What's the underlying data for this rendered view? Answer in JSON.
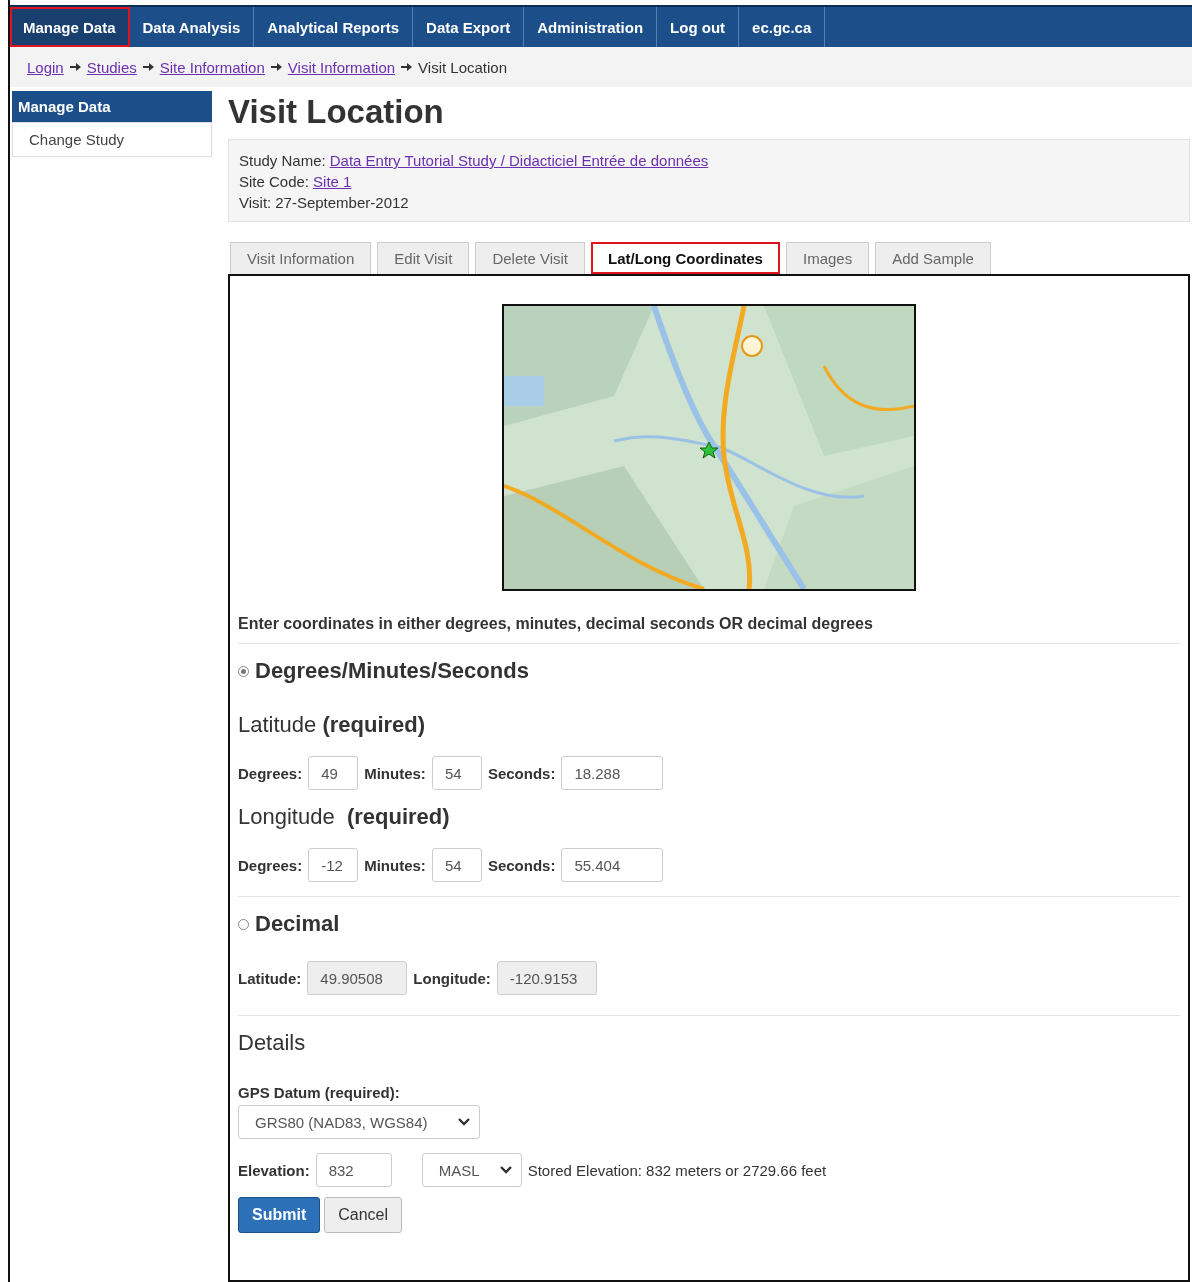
{
  "nav": {
    "items": [
      {
        "label": "Manage Data",
        "selected": true,
        "highlighted": true
      },
      {
        "label": "Data Analysis",
        "selected": false,
        "highlighted": false
      },
      {
        "label": "Analytical Reports",
        "selected": false,
        "highlighted": false
      },
      {
        "label": "Data Export",
        "selected": false,
        "highlighted": false
      },
      {
        "label": "Administration",
        "selected": false,
        "highlighted": false
      },
      {
        "label": "Log out",
        "selected": false,
        "highlighted": false
      },
      {
        "label": "ec.gc.ca",
        "selected": false,
        "highlighted": false
      }
    ]
  },
  "breadcrumb": [
    {
      "label": "Login",
      "link": true
    },
    {
      "label": "Studies",
      "link": true
    },
    {
      "label": "Site Information",
      "link": true
    },
    {
      "label": "Visit Information",
      "link": true
    },
    {
      "label": "Visit Location",
      "link": false
    }
  ],
  "sidebar": {
    "title": "Manage Data",
    "items": [
      {
        "label": "Change Study"
      }
    ]
  },
  "page_title": "Visit Location",
  "study_info": [
    {
      "label": "Study Name:",
      "value": "Data Entry Tutorial Study / Didacticiel Entrée de données",
      "link": true
    },
    {
      "label": "Site Code:",
      "value": "Site 1",
      "link": true
    },
    {
      "label": "Visit:",
      "value": "27-September-2012",
      "link": false
    }
  ],
  "tabs": [
    {
      "label": "Visit Information",
      "selected": false,
      "highlighted": false
    },
    {
      "label": "Edit Visit",
      "selected": false,
      "highlighted": false
    },
    {
      "label": "Delete Visit",
      "selected": false,
      "highlighted": false
    },
    {
      "label": "Lat/Long Coordinates",
      "selected": true,
      "highlighted": true
    },
    {
      "label": "Images",
      "selected": false,
      "highlighted": false
    },
    {
      "label": "Add Sample",
      "selected": false,
      "highlighted": false
    }
  ],
  "instructions": "Enter coordinates in either degrees, minutes, decimal seconds OR decimal degrees",
  "dms": {
    "label": "Degrees/Minutes/Seconds",
    "selected": true,
    "groups": [
      {
        "title": "Latitude **(required)**",
        "fields": [
          {
            "label": "Degrees:",
            "value": "49"
          },
          {
            "label": "Minutes:",
            "value": "54"
          },
          {
            "label": "Seconds:",
            "value": "18.288"
          }
        ]
      },
      {
        "title": "Longitude  **(required)**",
        "fields": [
          {
            "label": "Degrees:",
            "value": "-12"
          },
          {
            "label": "Minutes:",
            "value": "54"
          },
          {
            "label": "Seconds:",
            "value": "55.404"
          }
        ]
      }
    ]
  },
  "decimal": {
    "label": "Decimal",
    "selected": false,
    "fields": [
      {
        "label": "Latitude:",
        "value": "49.90508",
        "disabled": true
      },
      {
        "label": "Longitude:",
        "value": "-120.9153",
        "disabled": true
      }
    ]
  },
  "details": {
    "title": "Details",
    "datum": {
      "label": "GPS Datum (required):",
      "value": "GRS80 (NAD83, WGS84)"
    },
    "elevation": {
      "label": "Elevation:",
      "value": "832",
      "unit": "MASL",
      "stored": "Stored Elevation: 832 meters or 2729.66 feet"
    }
  },
  "buttons": [
    {
      "label": "Submit",
      "kind": "primary"
    },
    {
      "label": "Cancel",
      "kind": "default"
    }
  ]
}
